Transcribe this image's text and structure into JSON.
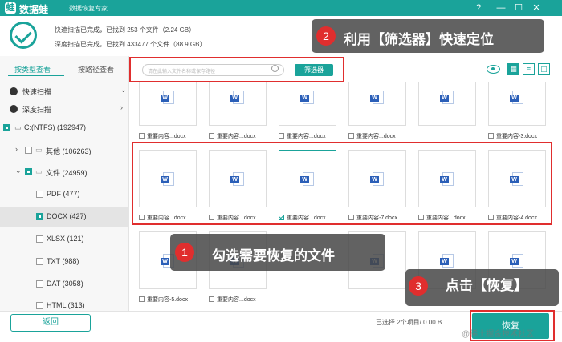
{
  "titlebar": {
    "app_name": "数据蛙",
    "subtitle": "数据恢复专家",
    "logo_char": "蛙",
    "help_icon": "?",
    "min_icon": "—",
    "max_icon": "☐",
    "close_icon": "✕"
  },
  "summary": {
    "quick_scan": "快速扫描已完成，已找到 253 个文件（2.24 GB）",
    "deep_scan": "深度扫描已完成，已找到 433477 个文件（88.9 GB）"
  },
  "callouts": [
    {
      "num": "1",
      "text": "勾选需要恢复的文件"
    },
    {
      "num": "2",
      "text": "利用【筛选器】快速定位"
    },
    {
      "num": "3",
      "text": "点击【恢复】"
    }
  ],
  "left": {
    "tabs": [
      "按类型查看",
      "按路径查看"
    ],
    "tree": [
      {
        "label": "快速扫描"
      },
      {
        "label": "深度扫描"
      },
      {
        "label": "C:(NTFS) (192947)"
      },
      {
        "label": "其他 (106263)"
      },
      {
        "label": "文件 (24959)"
      },
      {
        "label": "PDF (477)"
      },
      {
        "label": "DOCX (427)"
      },
      {
        "label": "XLSX (121)"
      },
      {
        "label": "TXT (988)"
      },
      {
        "label": "DAT (3058)"
      },
      {
        "label": "HTML (313)"
      }
    ]
  },
  "filterbar": {
    "search_placeholder": "请在此输入文件名称或保存路径",
    "filter_label": "筛选器"
  },
  "files": {
    "row1": [
      "重要内容...docx",
      "重要内容...docx",
      "重要内容...docx",
      "重要内容...docx",
      "重要内容-3.docx"
    ],
    "row2": [
      "重要内容...docx",
      "重要内容...docx",
      "重要内容...docx",
      "重要内容-7.docx",
      "重要内容...docx",
      "重要内容-4.docx"
    ],
    "row3": [
      "重要内容-5.docx",
      "重要内容...docx"
    ]
  },
  "bottom": {
    "back_label": "返回",
    "selected_status": "已选择 2个项目/ 0.00 B",
    "recover_label": "恢复",
    "watermark": "@稀土掘金技术社区"
  },
  "colors": {
    "accent": "#1aa39a",
    "highlight": "#e02e2e"
  }
}
